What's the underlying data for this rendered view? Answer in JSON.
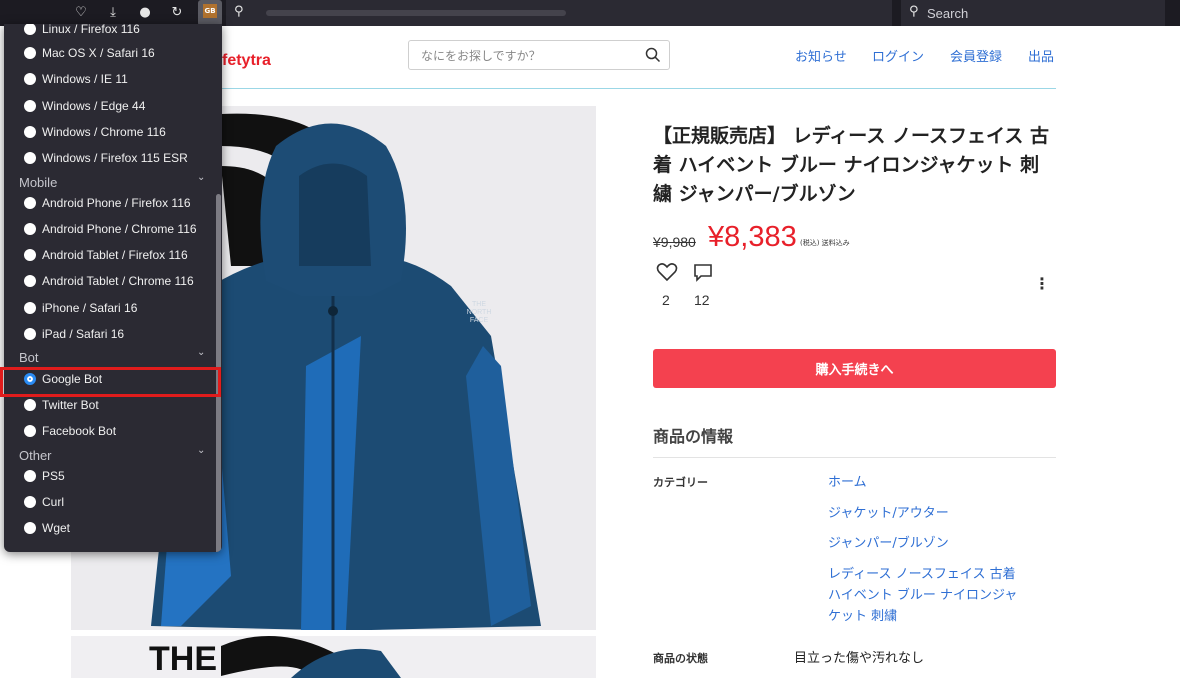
{
  "browser": {
    "search_placeholder": "Search",
    "extension_badge": "GB",
    "icons": [
      "pocket-icon",
      "download-icon",
      "circle-icon",
      "refresh-ext-icon",
      "gb-extension-icon",
      "search-icon"
    ]
  },
  "site": {
    "logo": "fetytra",
    "search_placeholder": "なにをお探しですか？",
    "nav": [
      "お知らせ",
      "ログイン",
      "会員登録",
      "出品"
    ]
  },
  "product": {
    "title": "【正規販売店】 レディース ノースフェイス 古着 ハイベント ブルー ナイロンジャケット 刺繍 ジャンパー/ブルゾン",
    "old_price": "¥9,980",
    "price": "¥8,383",
    "tax_note": "(税込) 送料込み",
    "likes": "2",
    "comments": "12",
    "buy_button": "購入手続きへ",
    "info_title": "商品の情報",
    "category_label": "カテゴリー",
    "categories": [
      "ホーム",
      "ジャケット/アウター",
      "ジャンパー/ブルゾン",
      "レディース ノースフェイス 古着",
      "ハイベント ブルー ナイロンジャ",
      "ケット 刺繍"
    ],
    "condition_label": "商品の状態",
    "condition_value": "目立った傷や汚れなし",
    "jacket_logo": "THE NORTH FACE",
    "photo2_text": "THE"
  },
  "popup": {
    "options_top": [
      "Linux / Firefox 116",
      "Mac OS X / Safari 16",
      "Windows / IE 11",
      "Windows / Edge 44",
      "Windows / Chrome 116",
      "Windows / Firefox 115 ESR"
    ],
    "group_mobile": "Mobile",
    "options_mobile": [
      "Android Phone / Firefox 116",
      "Android Phone / Chrome 116",
      "Android Tablet / Firefox 116",
      "Android Tablet / Chrome 116",
      "iPhone / Safari 16",
      "iPad / Safari 16"
    ],
    "group_bot": "Bot",
    "options_bot": [
      "Google Bot",
      "Twitter Bot",
      "Facebook Bot"
    ],
    "selected": "Google Bot",
    "group_other": "Other",
    "options_other": [
      "PS5",
      "Curl",
      "Wget"
    ]
  },
  "colors": {
    "accent_red": "#e8202a",
    "buy_button": "#f4414f",
    "link_blue": "#2f6fd4",
    "popup_bg": "#2b2a33",
    "highlight_box": "#e01c1c",
    "radio_selected": "#2a8cf5"
  }
}
